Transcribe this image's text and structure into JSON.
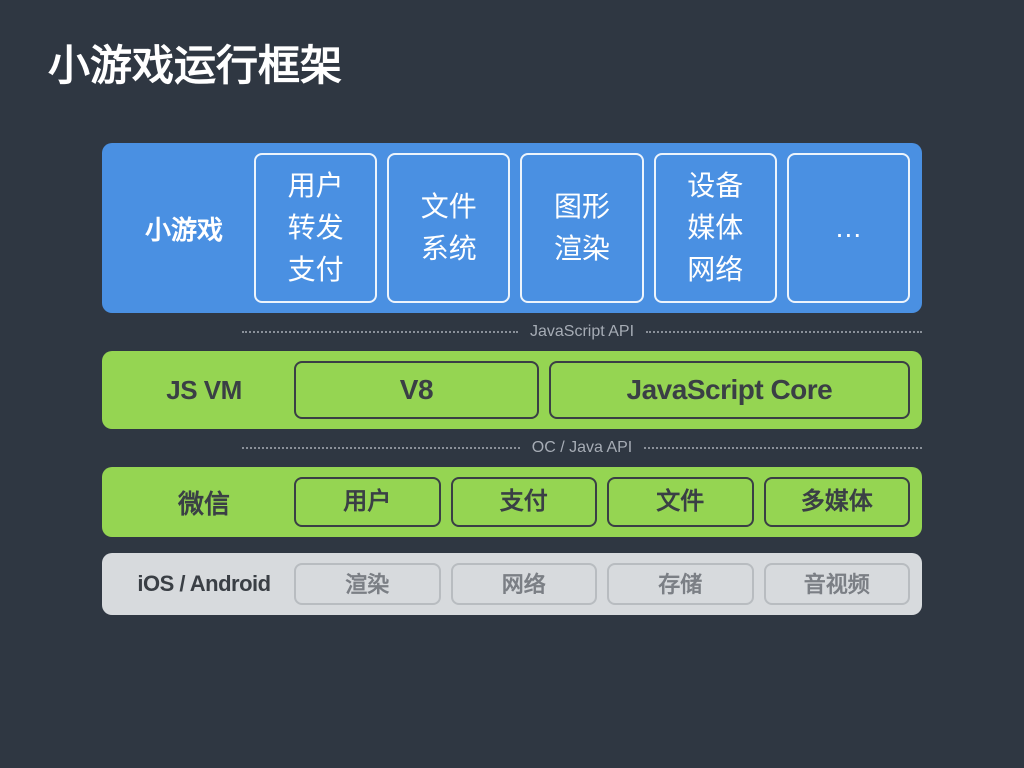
{
  "title": "小游戏运行框架",
  "layers": {
    "minigame": {
      "label": "小游戏",
      "boxes": [
        {
          "lines": [
            "用户",
            "转发",
            "支付"
          ]
        },
        {
          "lines": [
            "文件",
            "系统"
          ]
        },
        {
          "lines": [
            "图形",
            "渲染"
          ]
        },
        {
          "lines": [
            "设备",
            "媒体",
            "网络"
          ]
        },
        {
          "lines": [
            "…"
          ]
        }
      ]
    },
    "divider1": "JavaScript API",
    "jsvm": {
      "label": "JS VM",
      "boxes": [
        {
          "lines": [
            "V8"
          ]
        },
        {
          "lines": [
            "JavaScript Core"
          ]
        }
      ]
    },
    "divider2": "OC / Java API",
    "wechat": {
      "label": "微信",
      "boxes": [
        {
          "lines": [
            "用户"
          ]
        },
        {
          "lines": [
            "支付"
          ]
        },
        {
          "lines": [
            "文件"
          ]
        },
        {
          "lines": [
            "多媒体"
          ]
        }
      ]
    },
    "os": {
      "label": "iOS / Android",
      "boxes": [
        {
          "lines": [
            "渲染"
          ]
        },
        {
          "lines": [
            "网络"
          ]
        },
        {
          "lines": [
            "存储"
          ]
        },
        {
          "lines": [
            "音视频"
          ]
        }
      ]
    }
  }
}
